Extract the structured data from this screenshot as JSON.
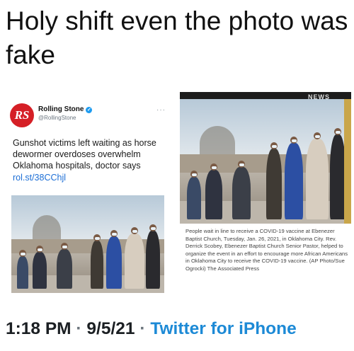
{
  "headline": "Holy shift even the photo was fake",
  "tweet": {
    "logo_text": "RS",
    "name": "Rolling Stone",
    "handle": "@RollingStone",
    "more": "···",
    "text": "Gunshot victims left waiting as horse dewormer overdoses overwhelm Oklahoma hospitals, doctor says",
    "link": "rol.st/38CChjl"
  },
  "ap_photo": {
    "banner_left": "",
    "banner_right": "NEWS",
    "caption": "People wait in line to receive a COVID-19 vaccine at Ebenezer Baptist Church, Tuesday, Jan. 26, 2021, in Oklahoma City. Rev. Derrick Scobey, Ebenezer Baptist Church Senior Pastor, helped to organize the event in an effort to encourage more African Americans in Oklahoma City to receive the COVID-19 vaccine. (AP Photo/Sue Ogrocki) The Associated Press"
  },
  "footer": {
    "time": "1:18 PM",
    "separator": "·",
    "date": "9/5/21",
    "source": "Twitter for iPhone"
  },
  "colors": {
    "link": "#1d6fd6",
    "footer_source": "#1d8ad6",
    "rs_logo": "#d51f26",
    "verified": "#1d9bf0"
  }
}
